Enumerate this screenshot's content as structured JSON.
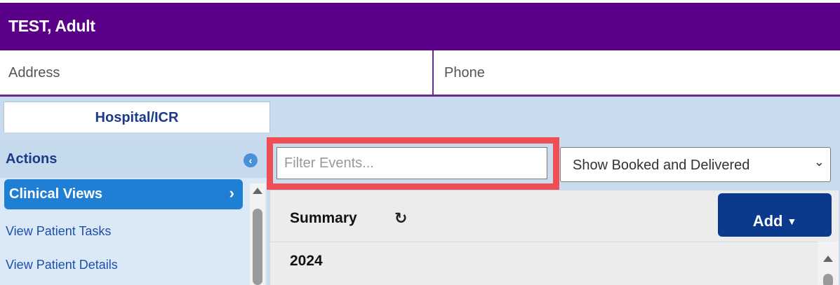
{
  "patient": {
    "name": "TEST, Adult",
    "address_label": "Address",
    "phone_label": "Phone"
  },
  "tabs": [
    {
      "label": "Hospital/ICR",
      "active": true
    }
  ],
  "sidebar": {
    "header": "Actions",
    "collapse_icon": "chevron-left-circle-icon",
    "items": [
      {
        "label": "Clinical Views",
        "selected": true
      },
      {
        "label": "View Patient Tasks"
      },
      {
        "label": "View Patient Details"
      }
    ]
  },
  "filter": {
    "placeholder": "Filter Events...",
    "value": ""
  },
  "event_select": {
    "selected": "Show Booked and Delivered"
  },
  "summary": {
    "title": "Summary",
    "refresh_icon": "refresh-icon",
    "add_label": "Add"
  },
  "events": {
    "years": [
      "2024"
    ]
  },
  "colors": {
    "header_purple": "#5a0088",
    "highlight_red": "#f04e55",
    "add_button_blue": "#0b3a8c",
    "selected_item_blue": "#1f7fd4"
  }
}
